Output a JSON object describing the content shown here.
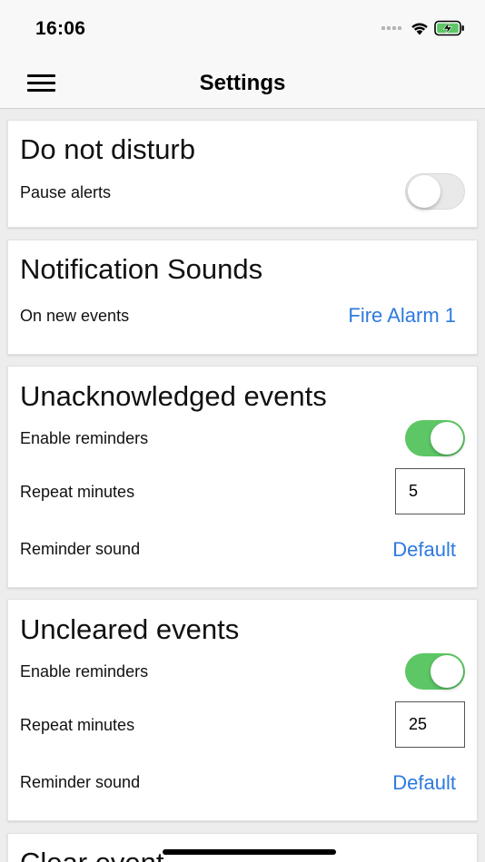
{
  "status": {
    "time": "16:06"
  },
  "nav": {
    "title": "Settings"
  },
  "dnd": {
    "title": "Do not disturb",
    "pause_label": "Pause alerts",
    "pause_on": false
  },
  "sounds": {
    "title": "Notification Sounds",
    "new_events_label": "On new events",
    "new_events_value": "Fire Alarm 1"
  },
  "unack": {
    "title": "Unacknowledged events",
    "enable_label": "Enable reminders",
    "enable_on": true,
    "repeat_label": "Repeat minutes",
    "repeat_value": "5",
    "sound_label": "Reminder sound",
    "sound_value": "Default"
  },
  "uncleared": {
    "title": "Uncleared events",
    "enable_label": "Enable reminders",
    "enable_on": true,
    "repeat_label": "Repeat minutes",
    "repeat_value": "25",
    "sound_label": "Reminder sound",
    "sound_value": "Default"
  },
  "clear": {
    "title": "Clear event"
  },
  "colors": {
    "accent": "#2d7ae0",
    "toggle_on": "#5dc765",
    "background": "#ededed"
  },
  "icons": {
    "menu": "hamburger-menu-icon",
    "wifi": "wifi-icon",
    "battery": "battery-charging-icon",
    "signal": "cellular-signal-icon"
  }
}
